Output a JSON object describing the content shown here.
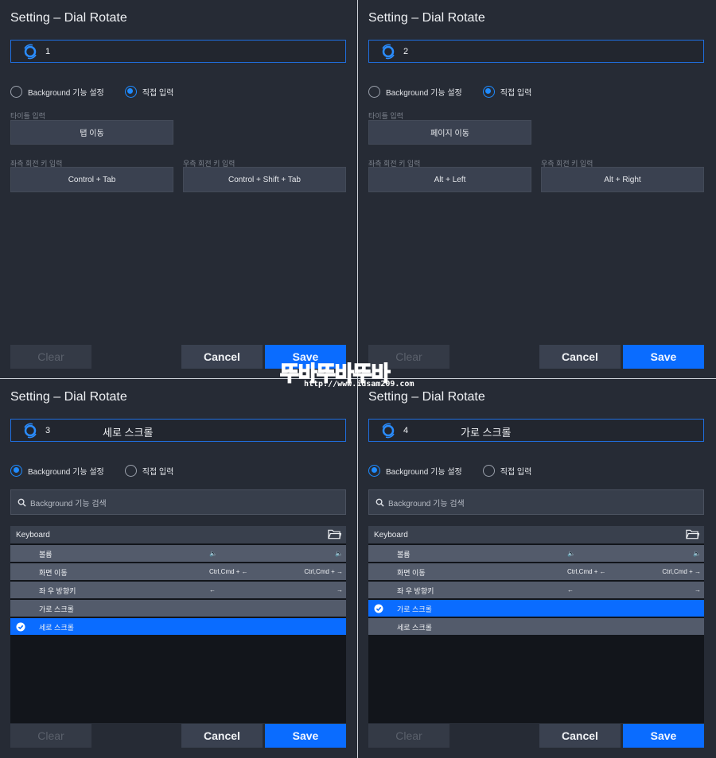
{
  "panels": [
    {
      "title": "Setting – Dial Rotate",
      "dial_number": "1",
      "dial_function": "",
      "radio_background": "Background 기능 설정",
      "radio_direct": "직접 입력",
      "selected_mode": "direct",
      "title_input_label": "타이틀 입력",
      "title_input_value": "탭 이동",
      "left_key_label": "좌측 회전 키 입력",
      "left_key_value": "Control + Tab",
      "right_key_label": "우측 회전 키 입력",
      "right_key_value": "Control + Shift + Tab",
      "clear_label": "Clear",
      "cancel_label": "Cancel",
      "save_label": "Save"
    },
    {
      "title": "Setting – Dial Rotate",
      "dial_number": "2",
      "dial_function": "",
      "radio_background": "Background 기능 설정",
      "radio_direct": "직접 입력",
      "selected_mode": "direct",
      "title_input_label": "타이틀 입력",
      "title_input_value": "페이지 이동",
      "left_key_label": "좌측 회전 키 입력",
      "left_key_value": "Alt + Left",
      "right_key_label": "우측 회전 키 입력",
      "right_key_value": "Alt + Right",
      "clear_label": "Clear",
      "cancel_label": "Cancel",
      "save_label": "Save"
    },
    {
      "title": "Setting – Dial Rotate",
      "dial_number": "3",
      "dial_function": "세로 스크롤",
      "radio_background": "Background 기능 설정",
      "radio_direct": "직접 입력",
      "selected_mode": "background",
      "search_placeholder": "Background 기능 검색",
      "list_header": "Keyboard",
      "rows": [
        {
          "label": "볼륨",
          "left": "🔈",
          "right": "🔈",
          "selected": false
        },
        {
          "label": "화면 이동",
          "left": "Ctrl,Cmd + ←",
          "right": "Ctrl,Cmd + →",
          "selected": false
        },
        {
          "label": "좌 우 방향키",
          "left": "←",
          "right": "→",
          "selected": false
        },
        {
          "label": "가로 스크롤",
          "left": "",
          "right": "",
          "selected": false
        },
        {
          "label": "세로 스크롤",
          "left": "",
          "right": "",
          "selected": true
        }
      ],
      "clear_label": "Clear",
      "cancel_label": "Cancel",
      "save_label": "Save"
    },
    {
      "title": "Setting – Dial Rotate",
      "dial_number": "4",
      "dial_function": "가로 스크롤",
      "radio_background": "Background 기능 설정",
      "radio_direct": "직접 입력",
      "selected_mode": "background",
      "search_placeholder": "Background 기능 검색",
      "list_header": "Keyboard",
      "rows": [
        {
          "label": "볼륨",
          "left": "🔈",
          "right": "🔈",
          "selected": false
        },
        {
          "label": "화면 이동",
          "left": "Ctrl,Cmd + ←",
          "right": "Ctrl,Cmd + →",
          "selected": false
        },
        {
          "label": "좌 우 방향키",
          "left": "←",
          "right": "→",
          "selected": false
        },
        {
          "label": "가로 스크롤",
          "left": "",
          "right": "",
          "selected": true
        },
        {
          "label": "세로 스크롤",
          "left": "",
          "right": "",
          "selected": false
        }
      ],
      "clear_label": "Clear",
      "cancel_label": "Cancel",
      "save_label": "Save"
    }
  ],
  "watermark": {
    "title": "뚜바뚜바뚜바",
    "url": "http://www.idsam209.com"
  },
  "colors": {
    "panel_bg": "#262b35",
    "accent": "#0a6cff",
    "button_bg": "#3a4150",
    "row_bg": "#535b6b"
  }
}
